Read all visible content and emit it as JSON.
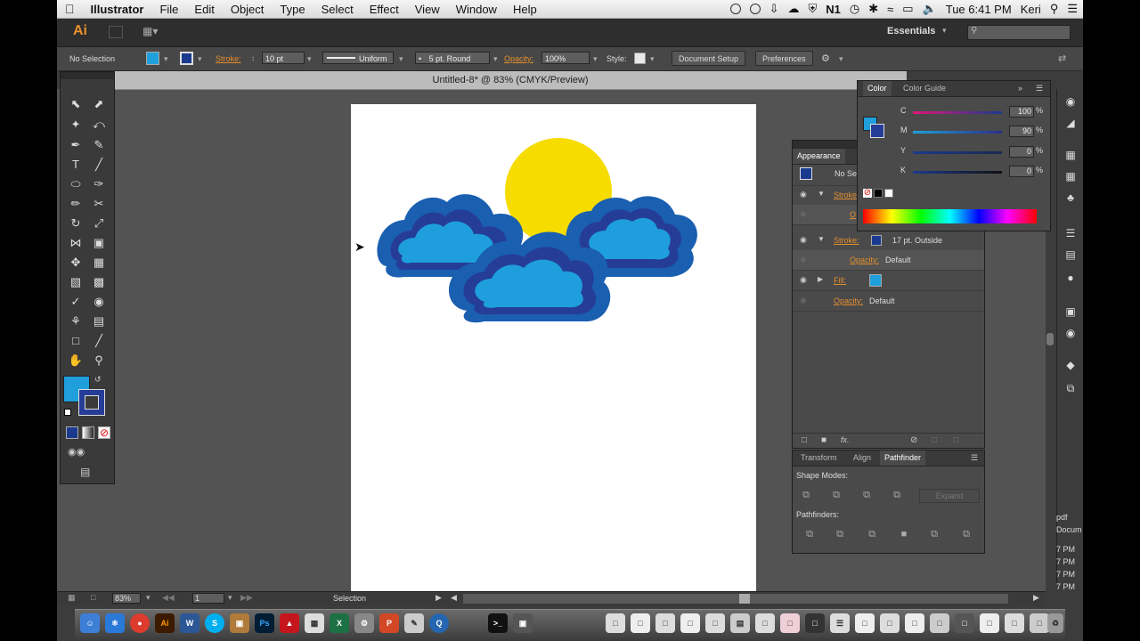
{
  "menubar": {
    "apple": "",
    "app_name": "Illustrator",
    "items": [
      "File",
      "Edit",
      "Object",
      "Type",
      "Select",
      "Effect",
      "View",
      "Window",
      "Help"
    ],
    "clock": "Tue 6:41 PM",
    "user": "Keri"
  },
  "appbar": {
    "logo": "Ai",
    "workspace": "Essentials"
  },
  "controlbar": {
    "selection": "No Selection",
    "stroke_label": "Stroke:",
    "stroke_weight": "10 pt",
    "profile": "Uniform",
    "brush": "5 pt. Round",
    "opacity_label": "Opacity:",
    "opacity_value": "100%",
    "style_label": "Style:",
    "doc_setup": "Document Setup",
    "preferences": "Preferences"
  },
  "document": {
    "title": "Untitled-8* @ 83% (CMYK/Preview)"
  },
  "colors": {
    "fill": "#1fa0dc",
    "stroke": "#1a3a8f",
    "sun": "#f7dc00",
    "cloud_fill": "#1e9edc",
    "cloud_inner_stroke": "#253d97",
    "cloud_outer_stroke": "#1a5fb0"
  },
  "color_panel": {
    "tab_color": "Color",
    "tab_guide": "Color Guide",
    "sliders": [
      {
        "label": "C",
        "value": "100",
        "unit": "%"
      },
      {
        "label": "M",
        "value": "90",
        "unit": "%"
      },
      {
        "label": "Y",
        "value": "0",
        "unit": "%"
      },
      {
        "label": "K",
        "value": "0",
        "unit": "%"
      }
    ]
  },
  "appearance_panel": {
    "title": "Appearance",
    "header": "No Se",
    "rows": {
      "stroke1": "Stroke",
      "opacity1_partial": "O",
      "stroke2": "Stroke:",
      "stroke2_value": "17 pt. Outside",
      "opacity2": "Opacity:",
      "opacity2_value": "Default",
      "fill": "Fill:",
      "opacity3": "Opacity:",
      "opacity3_value": "Default"
    },
    "fx": "fx."
  },
  "pathfinder_panel": {
    "tabs": [
      "Transform",
      "Align",
      "Pathfinder"
    ],
    "shape_modes": "Shape Modes:",
    "expand": "Expand",
    "pathfinders": "Pathfinders:"
  },
  "statusbar": {
    "zoom": "83%",
    "page": "1",
    "tool": "Selection"
  },
  "desktop_text": [
    "pdf",
    "Docum",
    "7 PM",
    "7 PM",
    "7 PM",
    "7 PM"
  ]
}
